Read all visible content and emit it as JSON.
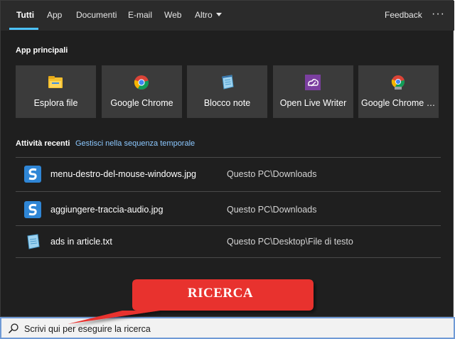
{
  "tabs": [
    {
      "label": "Tutti",
      "active": true
    },
    {
      "label": "App"
    },
    {
      "label": "Documenti"
    },
    {
      "label": "E-mail"
    },
    {
      "label": "Web"
    },
    {
      "label": "Altro"
    }
  ],
  "header": {
    "feedback_label": "Feedback",
    "more_icon": "more-horizontal-icon",
    "more_glyph": "···"
  },
  "top_apps": {
    "title": "App principali",
    "items": [
      {
        "label": "Esplora file",
        "icon": "folder-icon"
      },
      {
        "label": "Google Chrome",
        "icon": "chrome-icon"
      },
      {
        "label": "Blocco note",
        "icon": "notepad-icon"
      },
      {
        "label": "Open Live Writer",
        "icon": "live-writer-icon"
      },
      {
        "label": "Google Chrome B...",
        "icon": "chrome-beta-icon"
      }
    ]
  },
  "recent": {
    "title": "Attività recenti",
    "link": "Gestisci nella sequenza temporale",
    "items": [
      {
        "name": "menu-destro-del-mouse-windows.jpg",
        "path": "Questo PC\\Downloads",
        "icon": "snagit-icon"
      },
      {
        "name": "aggiungere-traccia-audio.jpg",
        "path": "Questo PC\\Downloads",
        "icon": "snagit-icon"
      },
      {
        "name": "ads in article.txt",
        "path": "Questo PC\\Desktop\\File di testo",
        "icon": "notepad-icon"
      }
    ]
  },
  "callout": {
    "text": "RICERCA",
    "color": "#e8322f"
  },
  "search": {
    "placeholder": "Scrivi qui per eseguire la ricerca",
    "icon": "search-icon"
  },
  "colors": {
    "accent": "#4cc2ff",
    "panel": "#1f1f1f",
    "tile": "#3b3b3b",
    "link": "#8cc8ff"
  }
}
